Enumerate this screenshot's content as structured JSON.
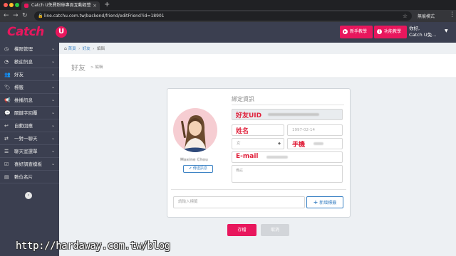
{
  "browser": {
    "tab_title": "Catch U免費粉絲專頁互動經營",
    "url": "line.catchu.com.tw/backend/friend/editFriend?id=18901",
    "incognito_label": "無痕模式"
  },
  "header": {
    "logo_text": "Catch",
    "logo_badge": "U",
    "btn_tutorial": "新手教學",
    "btn_features": "功能教學",
    "greeting": "你好,",
    "user_name": "Catch U免..."
  },
  "sidebar": {
    "items": [
      {
        "label": "權限管理",
        "icon": "dashboard-icon"
      },
      {
        "label": "歡迎訊息",
        "icon": "clock-icon"
      },
      {
        "label": "好友",
        "icon": "users-icon"
      },
      {
        "label": "標籤",
        "icon": "tag-icon"
      },
      {
        "label": "推播訊息",
        "icon": "megaphone-icon"
      },
      {
        "label": "關鍵字回覆",
        "icon": "comment-icon"
      },
      {
        "label": "自動回應",
        "icon": "reply-icon"
      },
      {
        "label": "一對一聊天",
        "icon": "exchange-icon"
      },
      {
        "label": "聊天室選單",
        "icon": "list-icon"
      },
      {
        "label": "喜好調查模板",
        "icon": "check-square-icon"
      },
      {
        "label": "數位名片",
        "icon": "id-card-icon"
      }
    ]
  },
  "breadcrumb": {
    "home": "首頁",
    "parent": "好友",
    "current": "編輯"
  },
  "page": {
    "title": "好友",
    "subtitle": "> 編輯"
  },
  "form": {
    "heading": "綁定資訊",
    "avatar_name": "Maxine Chou",
    "change_photo": "✔ 傳送訊息",
    "uid_label": "好友UID",
    "name_label": "姓名",
    "birthday_value": "1997-02-14",
    "gender_value": "女",
    "phone_label": "手機",
    "email_label": "E-mail",
    "note_placeholder": "備註",
    "tag_placeholder": "請輸入標籤",
    "add_tag": "新增標籤",
    "save": "存檔",
    "cancel": "取消"
  },
  "watermark": "http://hardaway.com.tw/blog",
  "colors": {
    "brand": "#e8175d",
    "sidebar": "#3b3f50",
    "link": "#3b82c4"
  }
}
